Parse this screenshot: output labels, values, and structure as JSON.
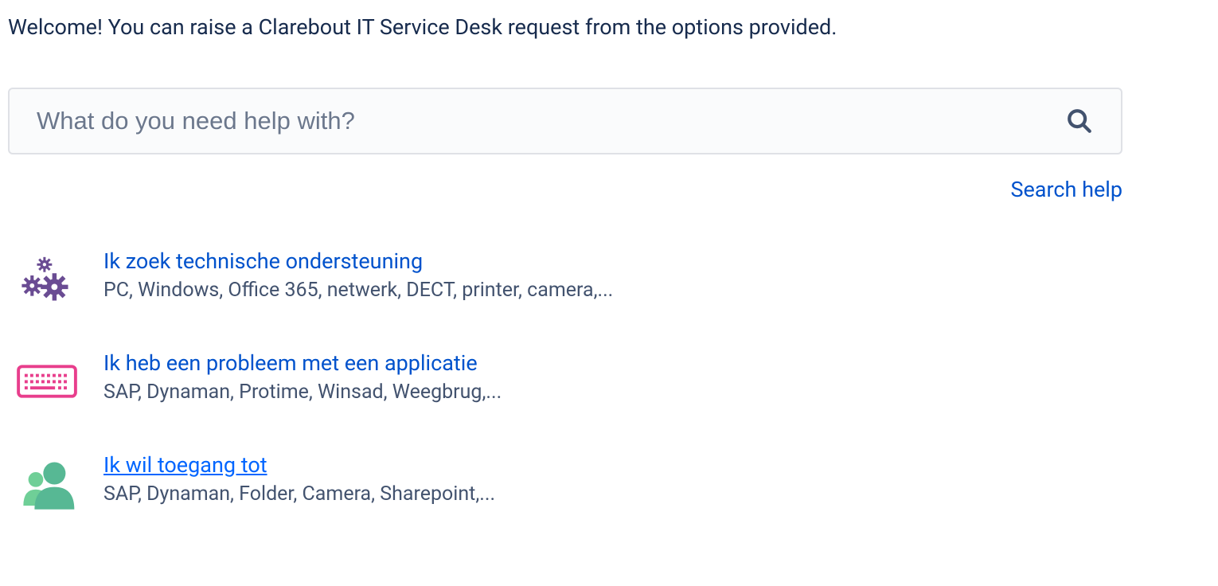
{
  "welcome_text": "Welcome! You can raise a Clarebout IT Service Desk request from the options provided.",
  "search": {
    "placeholder": "What do you need help with?",
    "value": "",
    "help_link": "Search help"
  },
  "requests": [
    {
      "id": "tech-support",
      "title": "Ik zoek technische ondersteuning",
      "description": "PC, Windows, Office 365, netwerk, DECT, printer, camera,...",
      "icon": "gears-icon",
      "hovered": false
    },
    {
      "id": "app-problem",
      "title": "Ik heb een probleem met een applicatie",
      "description": "SAP, Dynaman, Protime, Winsad, Weegbrug,...",
      "icon": "keyboard-icon",
      "hovered": false
    },
    {
      "id": "access",
      "title": "Ik wil toegang tot",
      "description": "SAP, Dynaman, Folder, Camera, Sharepoint,...",
      "icon": "people-icon",
      "hovered": true
    }
  ],
  "colors": {
    "link": "#0052CC",
    "link_hover": "#0065FF",
    "text_primary": "#172B4D",
    "text_secondary": "#42526E",
    "gears": "#6A4C93",
    "keyboard": "#E83E8C",
    "people": "#57B894"
  }
}
